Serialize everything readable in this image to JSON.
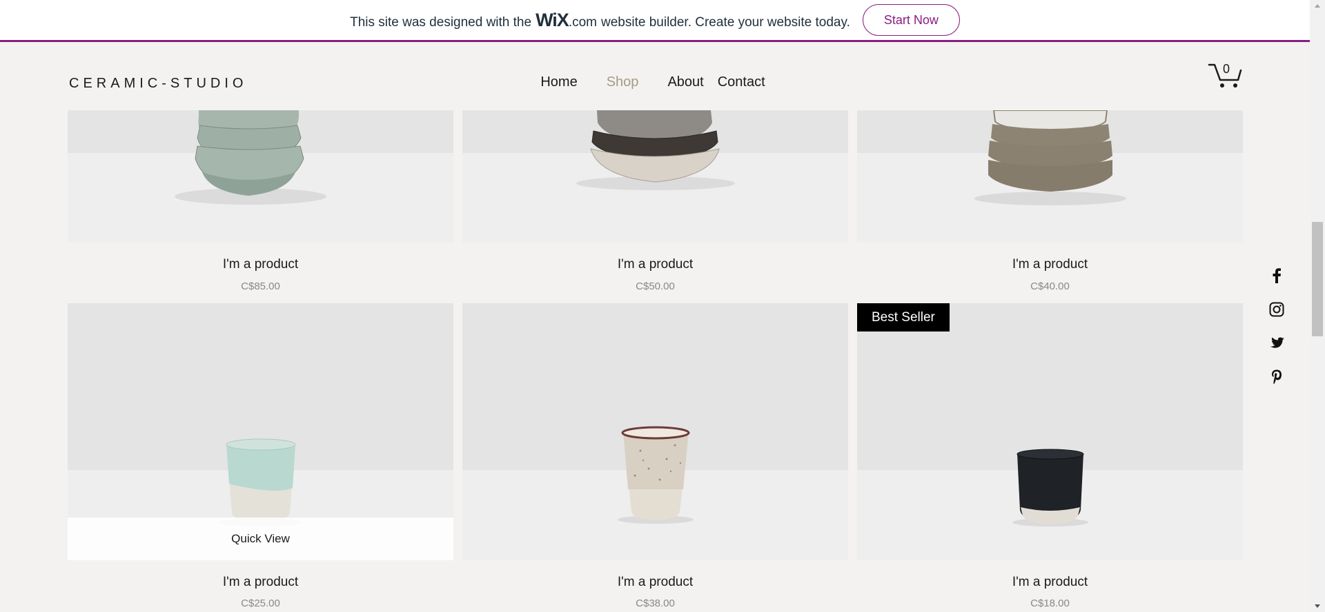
{
  "banner": {
    "text_before": "This site was designed with the",
    "logo_main": "WiX",
    "logo_suffix": ".com",
    "text_after": "website builder. Create your website today.",
    "cta_label": "Start Now",
    "accent": "#8a1b82"
  },
  "header": {
    "logo": "CERAMIC-STUDIO",
    "nav": [
      {
        "label": "Home",
        "active": false
      },
      {
        "label": "Shop",
        "active": true
      },
      {
        "label": "About",
        "active": false
      },
      {
        "label": "Contact",
        "active": false
      }
    ],
    "cart_count": "0",
    "cart_icon": "cart-icon"
  },
  "products": [
    {
      "name": "I'm a product",
      "price": "C$85.00",
      "image": "stacked-bowls-green"
    },
    {
      "name": "I'm a product",
      "price": "C$50.00",
      "image": "stacked-bowls-dark"
    },
    {
      "name": "I'm a product",
      "price": "C$40.00",
      "image": "stacked-bowls-taupe"
    },
    {
      "name": "I'm a product",
      "price": "C$25.00",
      "image": "cup-mint",
      "quick_view": "Quick View"
    },
    {
      "name": "I'm a product",
      "price": "C$38.00",
      "image": "cup-speckled"
    },
    {
      "name": "I'm a product",
      "price": "C$18.00",
      "image": "cup-black",
      "ribbon": "Best Seller"
    }
  ],
  "social": [
    {
      "name": "facebook-icon"
    },
    {
      "name": "instagram-icon"
    },
    {
      "name": "twitter-icon"
    },
    {
      "name": "pinterest-icon"
    }
  ]
}
